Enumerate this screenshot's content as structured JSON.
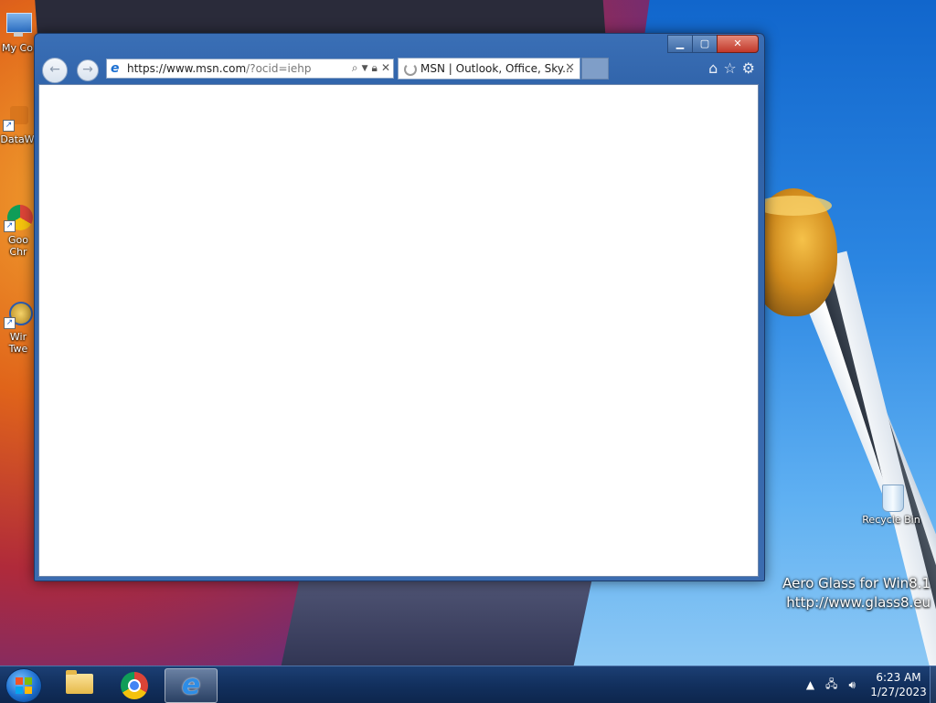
{
  "desktop": {
    "icons": [
      {
        "label": "My Co",
        "type": "computer"
      },
      {
        "label": "DataW",
        "type": "shortcut"
      },
      {
        "label": "Goo Chr",
        "type": "shortcut"
      },
      {
        "label": "Wir Twe",
        "type": "shortcut"
      }
    ],
    "recycle_bin_label": "Recycle Bin",
    "watermark": {
      "line1": "Aero Glass for Win8.1",
      "line2": "http://www.glass8.eu"
    }
  },
  "browser": {
    "window_controls": {
      "minimize": "▁",
      "maximize": "▢",
      "close": "✕"
    },
    "back_icon": "back-arrow-icon",
    "forward_icon": "forward-arrow-icon",
    "address": {
      "url_prefix": "https://www.msn.com",
      "url_suffix": "/?ocid=iehp"
    },
    "tab": {
      "title": "MSN | Outlook, Office, Sky...",
      "close": "✕"
    },
    "toolbar_icons": [
      "home-icon",
      "favorites-star-icon",
      "settings-gear-icon"
    ]
  },
  "taskbar": {
    "pinned": [
      "file-explorer-icon",
      "chrome-icon",
      "internet-explorer-icon"
    ],
    "active": "internet-explorer-icon",
    "clock": {
      "time": "6:23 AM",
      "date": "1/27/2023"
    }
  },
  "colors": {
    "taskbar": "#12305e",
    "window_frame": "#2f62a8",
    "close_button": "#c2382a"
  }
}
